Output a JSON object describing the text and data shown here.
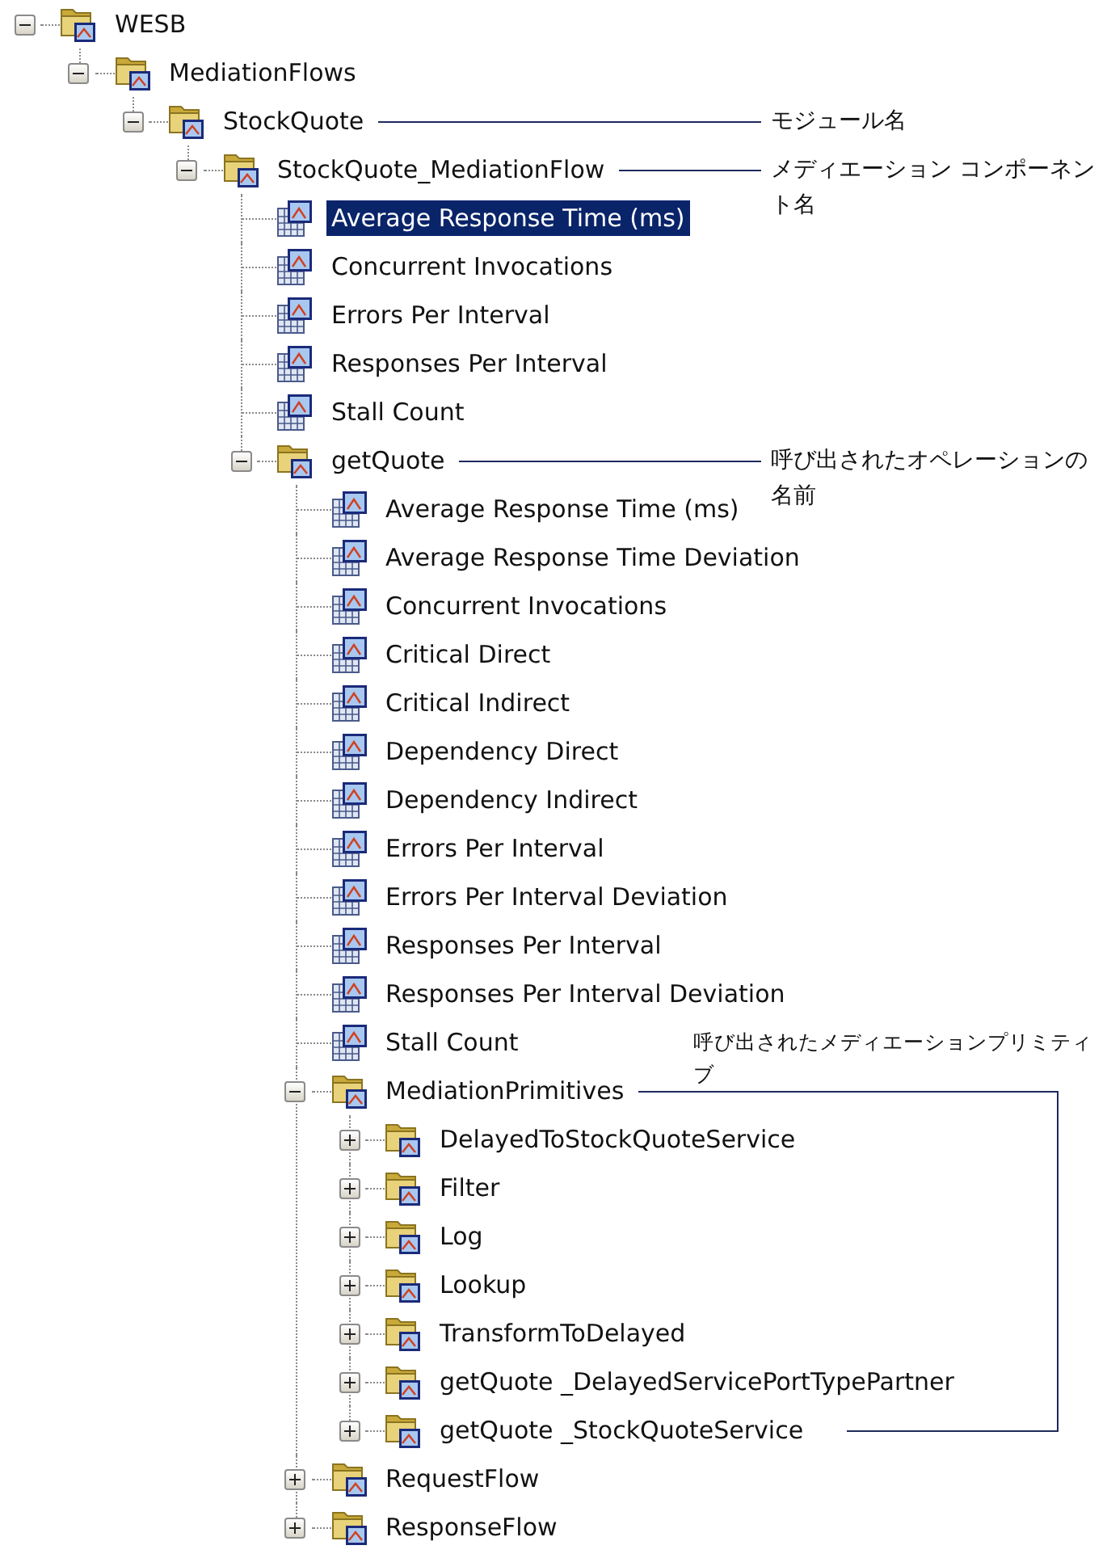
{
  "tree": {
    "root": {
      "label": "WESB",
      "kind": "folder",
      "expanded": true,
      "selected": false,
      "children": [
        {
          "label": "MediationFlows",
          "kind": "folder",
          "expanded": true,
          "selected": false,
          "children": [
            {
              "label": "StockQuote",
              "kind": "folder",
              "expanded": true,
              "selected": false,
              "annotation": {
                "kind": "leader",
                "text": "モジュール名"
              },
              "children": [
                {
                  "label": "StockQuote_MediationFlow",
                  "kind": "folder",
                  "expanded": true,
                  "selected": false,
                  "annotation": {
                    "kind": "leader",
                    "text": "メディエーション コンポーネント名"
                  },
                  "children": [
                    {
                      "label": "Average Response Time (ms)",
                      "kind": "metric",
                      "selected": true
                    },
                    {
                      "label": "Concurrent Invocations",
                      "kind": "metric",
                      "selected": false
                    },
                    {
                      "label": "Errors Per Interval",
                      "kind": "metric",
                      "selected": false
                    },
                    {
                      "label": "Responses Per Interval",
                      "kind": "metric",
                      "selected": false
                    },
                    {
                      "label": "Stall Count",
                      "kind": "metric",
                      "selected": false
                    },
                    {
                      "label": "getQuote",
                      "kind": "folder",
                      "expanded": true,
                      "selected": false,
                      "annotation": {
                        "kind": "leader",
                        "text": "呼び出されたオペレーションの名前"
                      },
                      "children": [
                        {
                          "label": "Average Response Time (ms)",
                          "kind": "metric",
                          "selected": false
                        },
                        {
                          "label": "Average Response Time Deviation",
                          "kind": "metric",
                          "selected": false
                        },
                        {
                          "label": "Concurrent Invocations",
                          "kind": "metric",
                          "selected": false
                        },
                        {
                          "label": "Critical Direct",
                          "kind": "metric",
                          "selected": false
                        },
                        {
                          "label": "Critical Indirect",
                          "kind": "metric",
                          "selected": false
                        },
                        {
                          "label": "Dependency Direct",
                          "kind": "metric",
                          "selected": false
                        },
                        {
                          "label": "Dependency Indirect",
                          "kind": "metric",
                          "selected": false
                        },
                        {
                          "label": "Errors Per Interval",
                          "kind": "metric",
                          "selected": false
                        },
                        {
                          "label": "Errors Per Interval Deviation",
                          "kind": "metric",
                          "selected": false
                        },
                        {
                          "label": "Responses Per Interval",
                          "kind": "metric",
                          "selected": false
                        },
                        {
                          "label": "Responses Per Interval Deviation",
                          "kind": "metric",
                          "selected": false
                        },
                        {
                          "label": "Stall Count",
                          "kind": "metric",
                          "selected": false
                        },
                        {
                          "label": "MediationPrimitives",
                          "kind": "folder",
                          "expanded": true,
                          "selected": false,
                          "annotation": {
                            "kind": "bracket",
                            "text": "呼び出されたメディエーションプリミティブ"
                          },
                          "children": [
                            {
                              "label": "DelayedToStockQuoteService",
                              "kind": "folder",
                              "expanded": false,
                              "selected": false
                            },
                            {
                              "label": "Filter",
                              "kind": "folder",
                              "expanded": false,
                              "selected": false
                            },
                            {
                              "label": "Log",
                              "kind": "folder",
                              "expanded": false,
                              "selected": false
                            },
                            {
                              "label": "Lookup",
                              "kind": "folder",
                              "expanded": false,
                              "selected": false
                            },
                            {
                              "label": "TransformToDelayed",
                              "kind": "folder",
                              "expanded": false,
                              "selected": false
                            },
                            {
                              "label": "getQuote _DelayedServicePortTypePartner",
                              "kind": "folder",
                              "expanded": false,
                              "selected": false
                            },
                            {
                              "label": "getQuote _StockQuoteService",
                              "kind": "folder",
                              "expanded": false,
                              "selected": false
                            }
                          ]
                        },
                        {
                          "label": "RequestFlow",
                          "kind": "folder",
                          "expanded": false,
                          "selected": false
                        },
                        {
                          "label": "ResponseFlow",
                          "kind": "folder",
                          "expanded": false,
                          "selected": false
                        }
                      ]
                    }
                  ]
                }
              ]
            }
          ]
        }
      ]
    }
  }
}
